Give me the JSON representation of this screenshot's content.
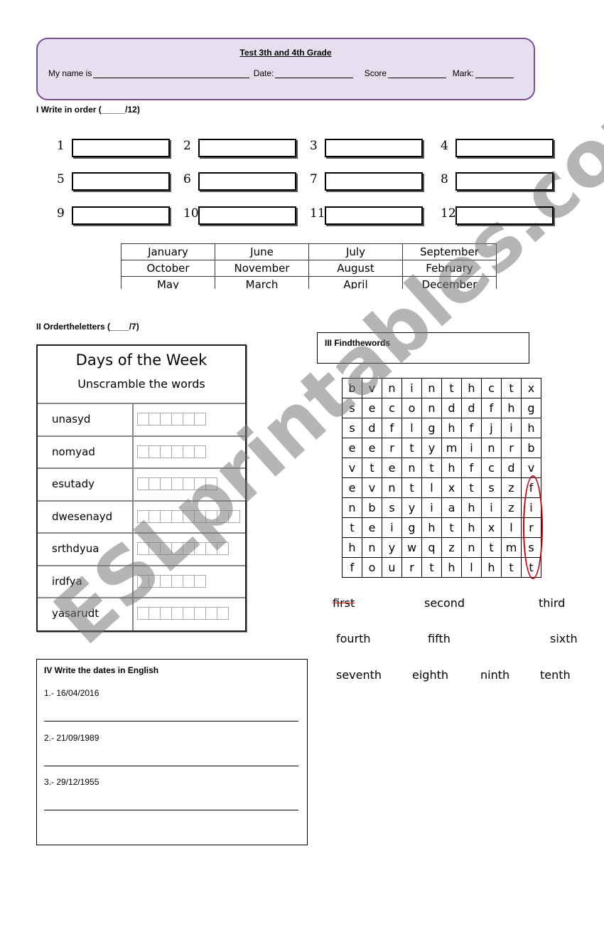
{
  "header": {
    "title": "Test 3th and 4th Grade",
    "name_label": "My name is",
    "date_label": "Date:",
    "score_label": "Score",
    "mark_label": "Mark:"
  },
  "section1": {
    "title": "I Write in order (_____/12)",
    "numbers": [
      "1",
      "2",
      "3",
      "4",
      "5",
      "6",
      "7",
      "8",
      "9",
      "10",
      "11",
      "12"
    ],
    "months": [
      [
        "January",
        "June",
        "July",
        "September"
      ],
      [
        "October",
        "November",
        "August",
        "February"
      ],
      [
        "May",
        "March",
        "April",
        "December"
      ]
    ]
  },
  "section2": {
    "title": "II Ordertheletters (____/7)",
    "box_title": "Days of the Week",
    "box_subtitle": "Unscramble the words",
    "words": [
      {
        "word": "unasyd",
        "letters": 6
      },
      {
        "word": "nomyad",
        "letters": 6
      },
      {
        "word": "esutady",
        "letters": 7
      },
      {
        "word": "dwesenayd",
        "letters": 9
      },
      {
        "word": "srthdyua",
        "letters": 8
      },
      {
        "word": "irdfya",
        "letters": 6
      },
      {
        "word": "yasarudt",
        "letters": 8
      }
    ]
  },
  "section3": {
    "title": "III Findthewords",
    "grid": [
      [
        "b",
        "v",
        "n",
        "i",
        "n",
        "t",
        "h",
        "c",
        "t",
        "x"
      ],
      [
        "s",
        "e",
        "c",
        "o",
        "n",
        "d",
        "d",
        "f",
        "h",
        "g"
      ],
      [
        "s",
        "d",
        "f",
        "l",
        "g",
        "h",
        "f",
        "j",
        "i",
        "h"
      ],
      [
        "e",
        "e",
        "r",
        "t",
        "y",
        "m",
        "i",
        "n",
        "r",
        "b"
      ],
      [
        "v",
        "t",
        "e",
        "n",
        "t",
        "h",
        "f",
        "c",
        "d",
        "v"
      ],
      [
        "e",
        "v",
        "n",
        "t",
        "l",
        "x",
        "t",
        "s",
        "z",
        "f"
      ],
      [
        "n",
        "b",
        "s",
        "y",
        "i",
        "a",
        "h",
        "i",
        "z",
        "i"
      ],
      [
        "t",
        "e",
        "i",
        "g",
        "h",
        "t",
        "h",
        "x",
        "l",
        "r"
      ],
      [
        "h",
        "n",
        "y",
        "w",
        "q",
        "z",
        "n",
        "t",
        "m",
        "s"
      ],
      [
        "f",
        "o",
        "u",
        "r",
        "t",
        "h",
        "l",
        "h",
        "t",
        "t"
      ]
    ],
    "words": [
      "first",
      "second",
      "third",
      "fourth",
      "fifth",
      "sixth",
      "seventh",
      "eighth",
      "ninth",
      "tenth"
    ],
    "found_color": "#cc0000"
  },
  "section4": {
    "title": "IV Write the dates in English",
    "items": [
      "1.- 16/04/2016",
      "2.- 21/09/1989",
      "3.- 29/12/1955"
    ]
  },
  "watermark": "ESLprintables.com"
}
